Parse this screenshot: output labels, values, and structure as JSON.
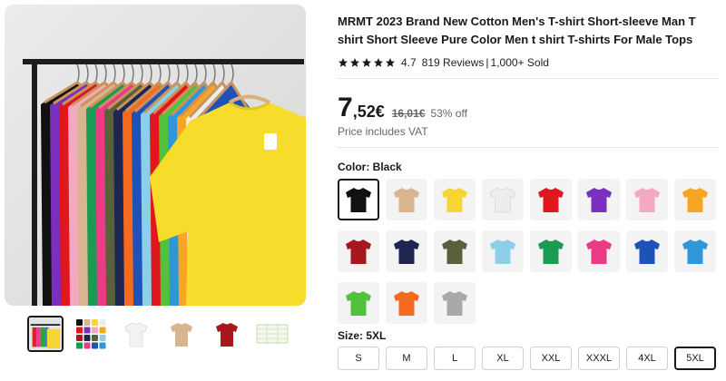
{
  "product": {
    "title": "MRMT 2023 Brand New Cotton Men's T-shirt Short-sleeve Man T shirt Short Sleeve Pure Color Men t shirt T-shirts For Male Tops"
  },
  "rating": {
    "value": "4.7",
    "stars": 5,
    "reviews": "819 Reviews",
    "separator": "|",
    "sold": "1,000+ Sold",
    "star_color": "#191919"
  },
  "price": {
    "integer": "7",
    "decimal": ",52€",
    "original": "16,01€",
    "discount": "53% off",
    "vat_note": "Price includes VAT"
  },
  "gallery": {
    "main_image": "tshirts-on-rack-photo",
    "thumbnails": [
      {
        "name": "tshirts-on-rack-thumb",
        "selected": true
      },
      {
        "name": "color-grid-thumb",
        "selected": false
      },
      {
        "name": "white-tshirt-thumb",
        "selected": false
      },
      {
        "name": "khaki-tshirt-thumb",
        "selected": false
      },
      {
        "name": "burgundy-tshirt-thumb",
        "selected": false
      },
      {
        "name": "size-chart-thumb",
        "selected": false
      }
    ]
  },
  "color": {
    "label": "Color: Black",
    "selected_index": 0,
    "swatches": [
      {
        "color": "#111111"
      },
      {
        "color": "#d8b48f"
      },
      {
        "color": "#f6d632"
      },
      {
        "color": "#ededed"
      },
      {
        "color": "#e0181e"
      },
      {
        "color": "#7b2fbe"
      },
      {
        "color": "#f3a9bf"
      },
      {
        "color": "#f6a623"
      },
      {
        "color": "#a8161e"
      },
      {
        "color": "#1d2552"
      },
      {
        "color": "#59613a"
      },
      {
        "color": "#8ccfe8"
      },
      {
        "color": "#1a9a52"
      },
      {
        "color": "#ec3b86"
      },
      {
        "color": "#1f52b8"
      },
      {
        "color": "#2f96d8"
      },
      {
        "color": "#52c23c"
      },
      {
        "color": "#f46a1f"
      },
      {
        "color": "#a9a9ab"
      }
    ]
  },
  "size": {
    "label": "Size: 5XL",
    "options": [
      "S",
      "M",
      "L",
      "XL",
      "XXL",
      "XXXL",
      "4XL",
      "5XL"
    ],
    "selected_index": 7
  }
}
